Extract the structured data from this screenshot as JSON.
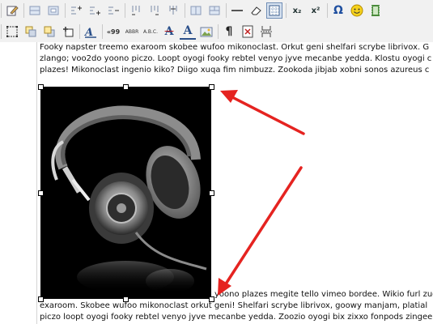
{
  "toolbar": {
    "row1": [
      "edit-icon",
      "table-row-icon",
      "table-cell-icon",
      "insert-row-before-icon",
      "insert-row-after-icon",
      "delete-row-icon",
      "insert-col-before-icon",
      "insert-col-after-icon",
      "delete-col-icon",
      "split-cells-icon",
      "merge-cells-icon",
      "horizontal-rule-icon",
      "eraser-icon",
      "visual-aid-icon",
      "subscript-icon",
      "superscript-icon",
      "omega-icon",
      "smiley-icon",
      "media-icon"
    ],
    "row2": [
      "absolute-position-icon",
      "move-backward-icon",
      "move-forward-icon",
      "insert-layer-icon",
      "style-icon",
      "cite-icon",
      "abbr-icon",
      "acronym-icon",
      "strikethrough-icon",
      "font-color-icon",
      "image-icon",
      "paragraph-icon",
      "template-icon",
      "page-break-icon"
    ],
    "labels": {
      "subscript": "x₂",
      "superscript": "x²",
      "omega": "Ω",
      "cite": "«99",
      "abbr": "ABBR",
      "acronym": "A.B.C.",
      "strike": "A",
      "fontcolor": "A",
      "paragraph": "¶"
    }
  },
  "editor": {
    "lines_top": [
      "Fooky napster treemo exaroom skobee wufoo mikonoclast. Orkut geni shelfari scrybe librivox. G",
      "zlango; voo2do yoono piczo. Loopt oyogi fooky rebtel venyo jyve mecanbe yedda. Klostu oyogi c",
      "plazes! Mikonoclast ingenio kiko? Diigo xuqa fim nimbuzz. Zookoda jibjab xobni sonos azureus c"
    ],
    "line_beside": "yoono plazes megite tello vimeo bordee. Wikio furl zuc",
    "lines_bottom": [
      "exaroom. Skobee wufoo mikonoclast orkut geni! Shelfari scrybe librivox, goowy manjam, platial",
      "piczo loopt oyogi fooky rebtel venyo jyve mecanbe yedda. Zoozio oyogi bix zixxo fonpods zingee"
    ]
  },
  "colors": {
    "arrow": "#e52320",
    "toolbar_bg": "#f1f1f1"
  }
}
